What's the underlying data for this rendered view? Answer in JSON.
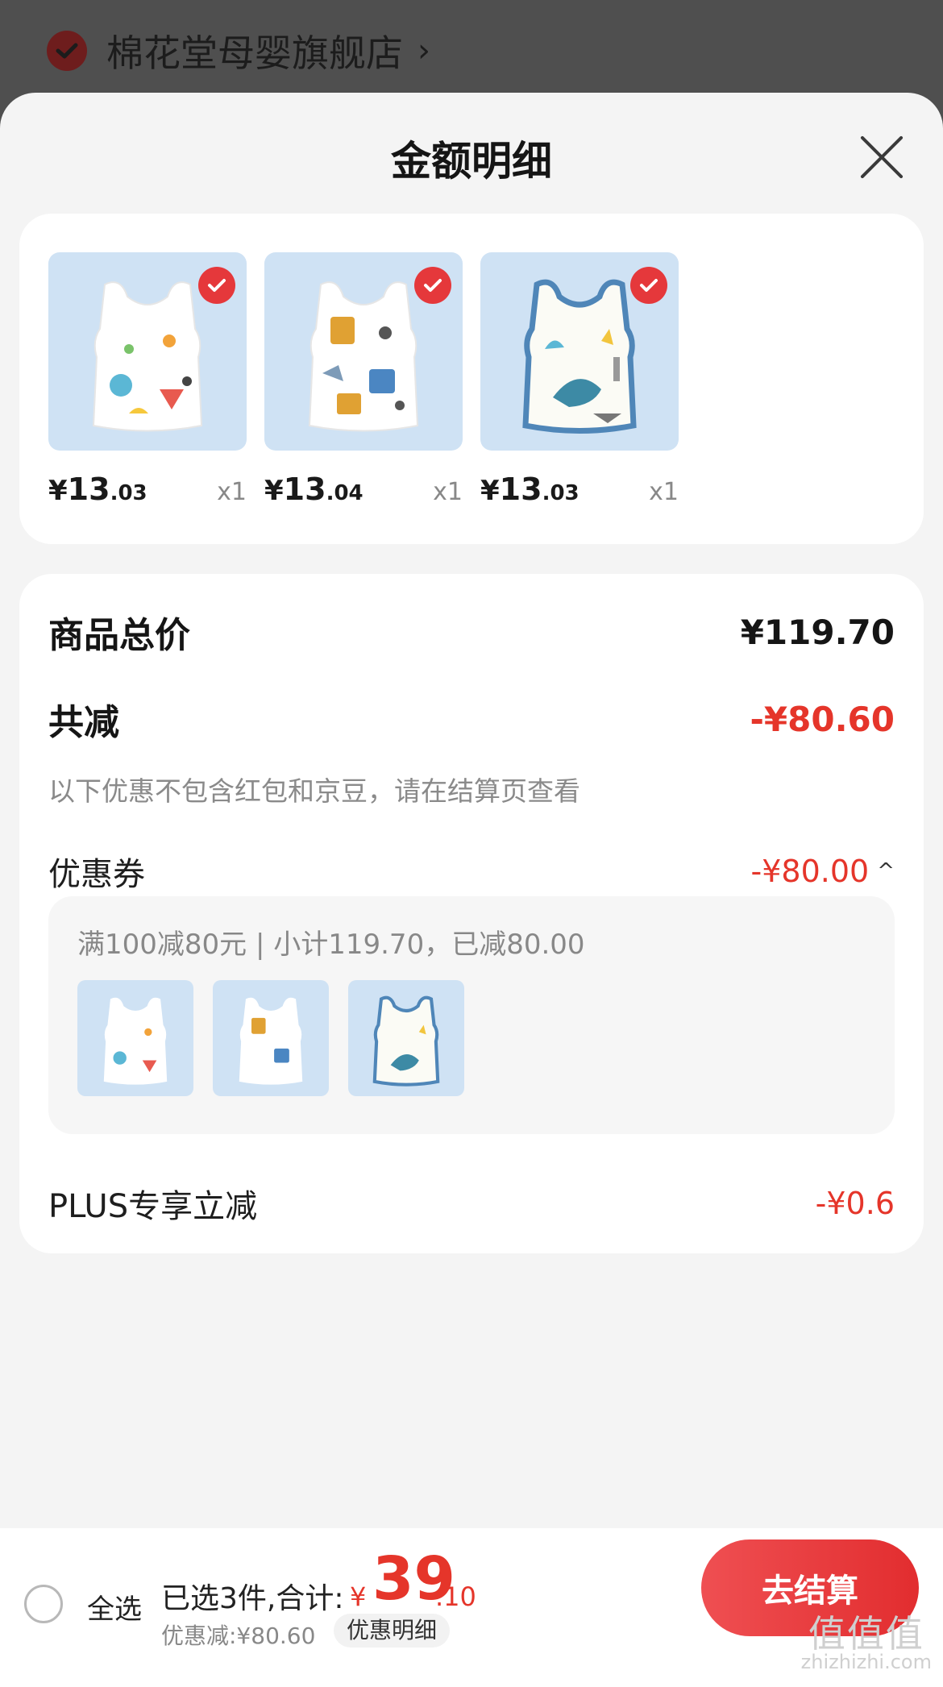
{
  "store": {
    "name": "棉花堂母婴旗舰店",
    "chevron": "›"
  },
  "sheet": {
    "title": "金额明细"
  },
  "products": [
    {
      "price_currency": "¥",
      "price_int": "13",
      "price_dec": ".03",
      "qty": "x1",
      "image": "fruit-pattern-vest"
    },
    {
      "price_currency": "¥",
      "price_int": "13",
      "price_dec": ".04",
      "qty": "x1",
      "image": "robot-pattern-vest"
    },
    {
      "price_currency": "¥",
      "price_int": "13",
      "price_dec": ".03",
      "qty": "x1",
      "image": "dinosaur-pattern-vest"
    }
  ],
  "summary": {
    "goods_total_label": "商品总价",
    "goods_total_value": "¥119.70",
    "reduction_label": "共减",
    "reduction_value": "-¥80.60",
    "reduction_note": "以下优惠不包含红包和京豆，请在结算页查看",
    "coupon_label": "优惠券",
    "coupon_value": "-¥80.00",
    "coupon_caret": "^",
    "coupon_desc": "满100减80元 | 小计119.70，已减80.00",
    "plus_label": "PLUS专享立减",
    "plus_value": "-¥0.6"
  },
  "bottom": {
    "select_all": "全选",
    "selected": "已选3件,合计:",
    "total_currency": "¥",
    "total_int": "39",
    "total_dec": ".10",
    "discount": "优惠减:¥80.60",
    "detail_link": "优惠明细",
    "checkout": "去结算"
  },
  "watermark": {
    "big": "值值值",
    "small": "zhizhizhi.com"
  },
  "colors": {
    "accent_red": "#e5352a",
    "check_red": "#e5383b",
    "thumb_bg": "#cfe2f4"
  }
}
